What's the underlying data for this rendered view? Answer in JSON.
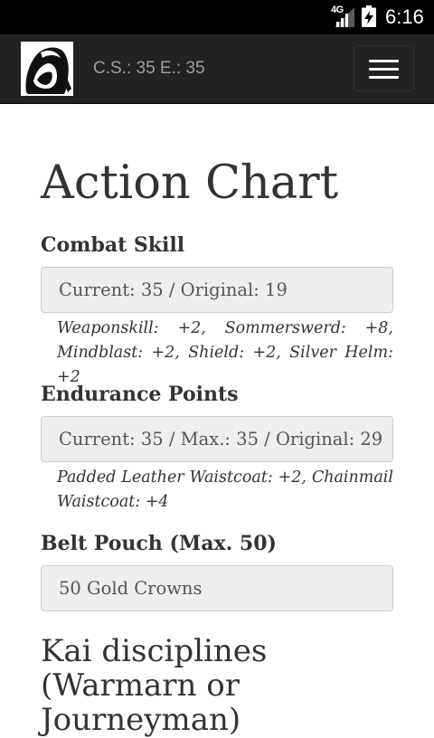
{
  "status_bar": {
    "network": "4G",
    "time": "6:16"
  },
  "navbar": {
    "stats": "C.S.: 35 E.: 35",
    "logo_icon": "hooded-kai-lord-logo-icon",
    "menu_icon": "hamburger-menu-icon"
  },
  "page": {
    "title": "Action Chart"
  },
  "combat_skill": {
    "label": "Combat Skill",
    "value": "Current: 35 / Original: 19",
    "bonuses": "Weaponskill: +2, Sommerswerd: +8, Mindblast: +2, Shield: +2, Silver Helm: +2"
  },
  "endurance": {
    "label": "Endurance Points",
    "value": "Current: 35 / Max.: 35 / Original: 29",
    "bonuses": "Padded Leather Waistcoat: +2, Chainmail Waistcoat: +4"
  },
  "belt_pouch": {
    "label": "Belt Pouch (Max. 50)",
    "value": "50 Gold Crowns"
  },
  "kai_disciplines": {
    "heading": "Kai disciplines (Warmarn or Journeyman)"
  }
}
